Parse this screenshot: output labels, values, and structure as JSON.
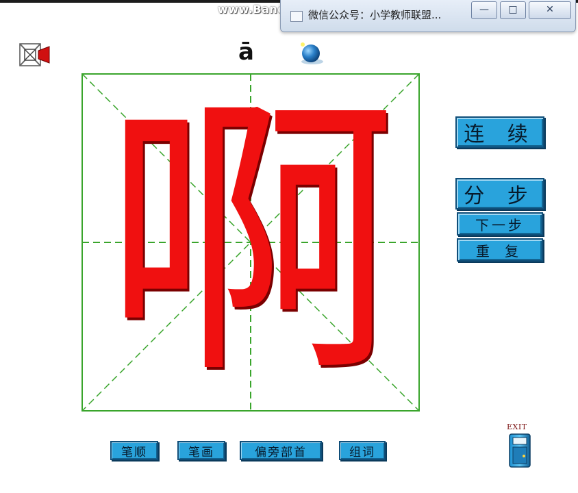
{
  "overlay": {
    "watermark": "www.Bandicam.com"
  },
  "os_window": {
    "title": "微信公众号：小学教师联盟...",
    "minimize": "—",
    "maximize": "□",
    "close": "✕"
  },
  "header": {
    "pinyin": "ā"
  },
  "character": {
    "glyph": "啊",
    "color": "#f01010",
    "grid_color": "#3aa52c"
  },
  "controls": {
    "continuous": "连 续",
    "step_mode": "分 步",
    "next_step": "下一步",
    "repeat": "重 复"
  },
  "bottom_nav": {
    "stroke_order": "笔顺",
    "strokes": "笔画",
    "radical": "偏旁部首",
    "words": "组词"
  },
  "exit": {
    "label": "EXIT"
  },
  "icons": {
    "tool": "puzzle-tool-icon",
    "globe": "globe-icon",
    "exit": "exit-door-icon"
  },
  "colors": {
    "button_fill": "#29a3dc",
    "button_border": "#0f4e79"
  }
}
